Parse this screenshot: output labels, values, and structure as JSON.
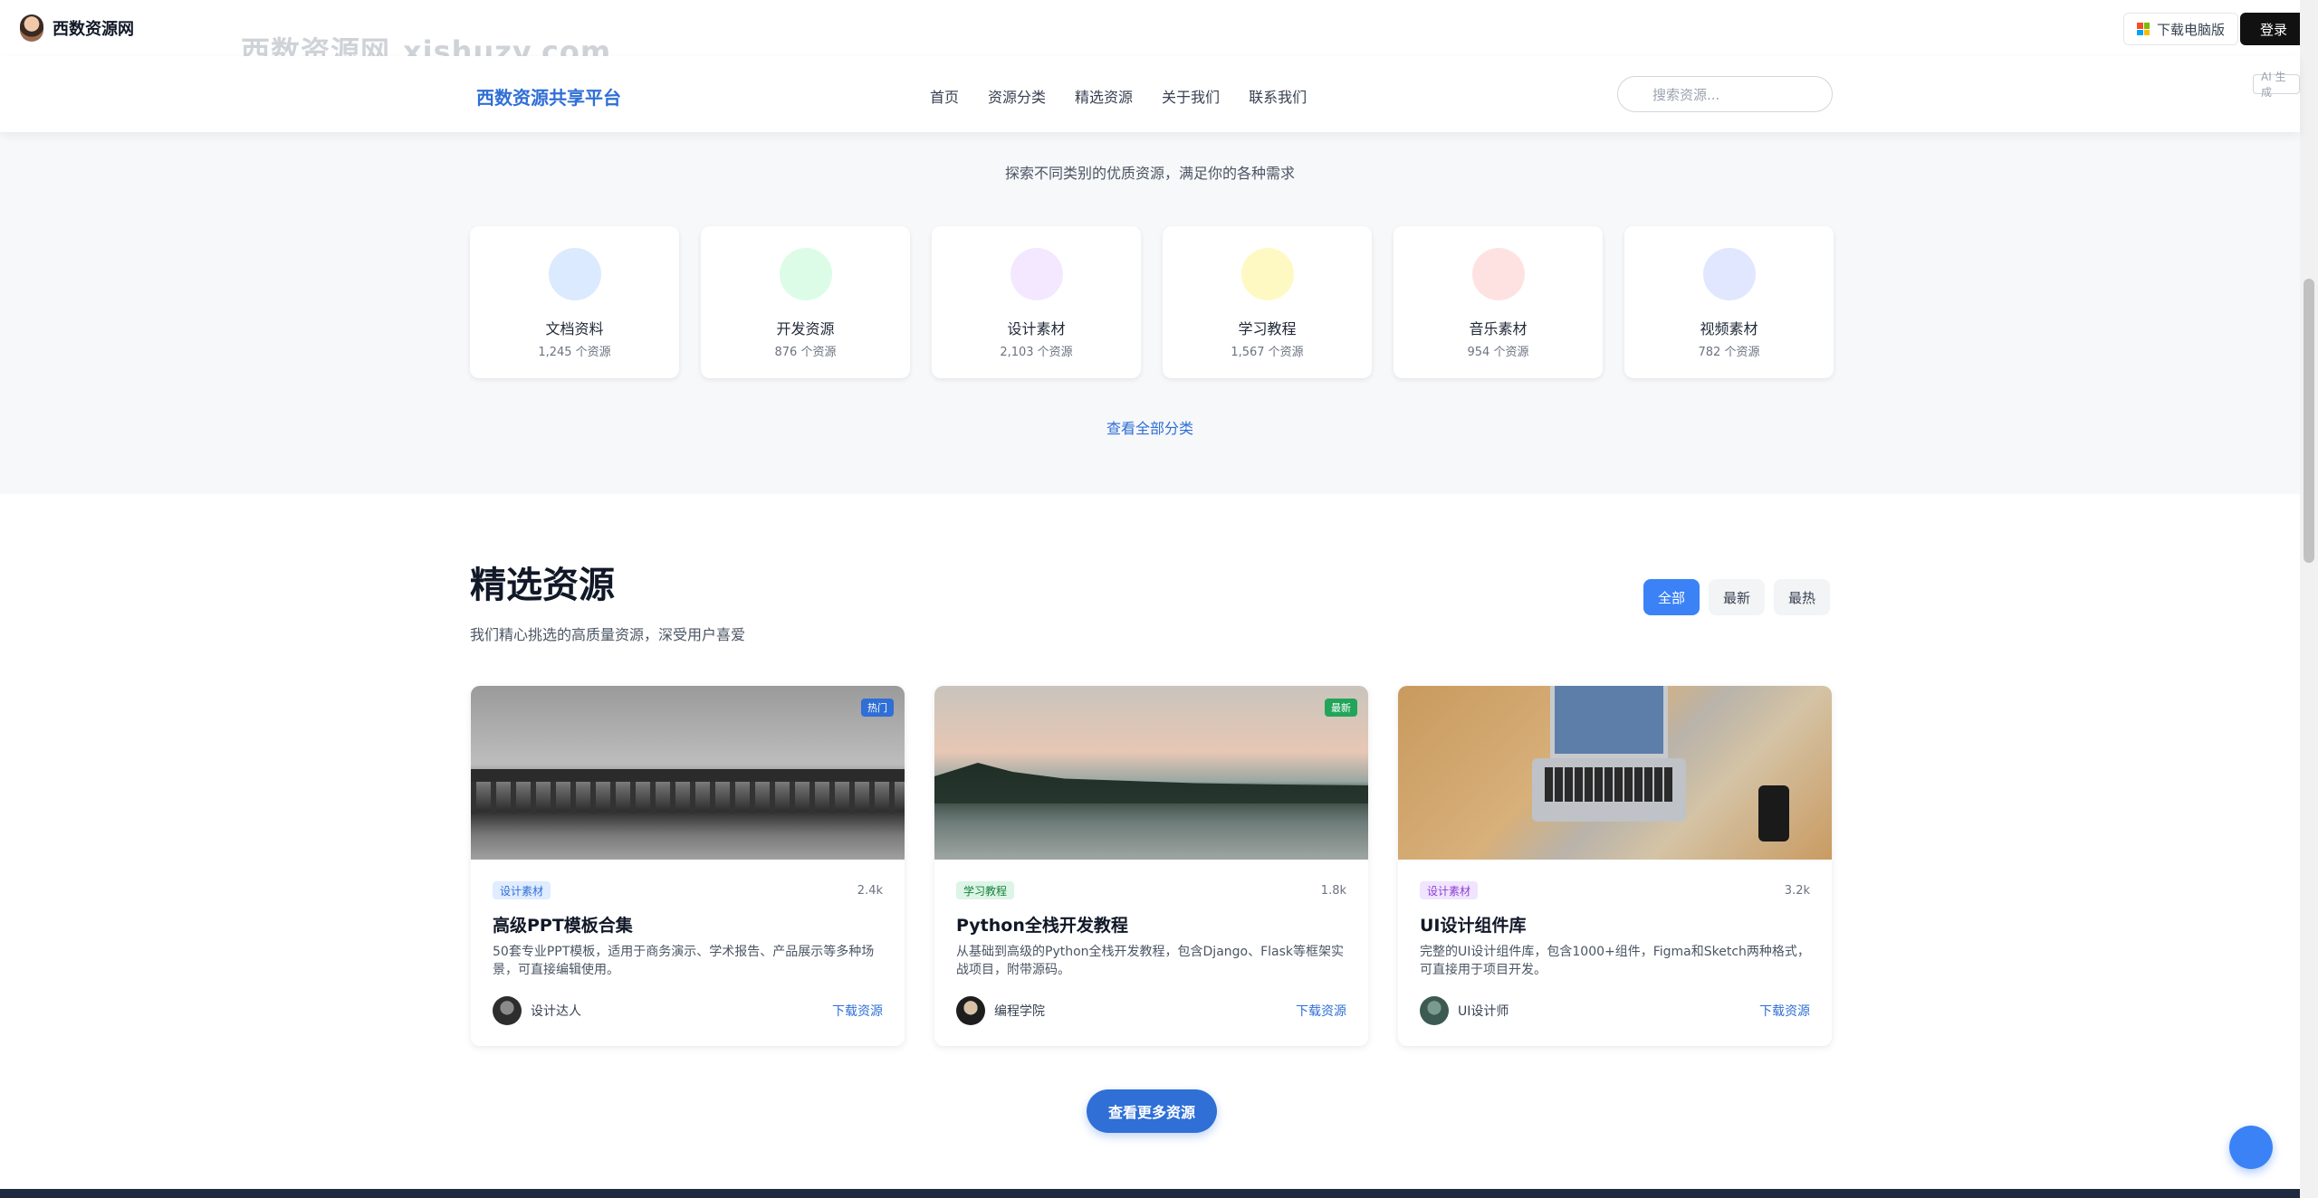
{
  "topbar": {
    "brand_name": "西数资源网",
    "watermark_cn": "西数资源网",
    "watermark_en": "xishuzy.com",
    "download_pc_label": "下载电脑版",
    "login_label": "登录"
  },
  "nav": {
    "site_title": "西数资源共享平台",
    "links": [
      "首页",
      "资源分类",
      "精选资源",
      "关于我们",
      "联系我们"
    ],
    "search_placeholder": "搜索资源...",
    "ai_tag": "AI 生成"
  },
  "categories": {
    "subtitle": "探索不同类别的优质资源，满足你的各种需求",
    "items": [
      {
        "name": "文档资料",
        "count": "1,245 个资源",
        "color": "#dbeafe"
      },
      {
        "name": "开发资源",
        "count": "876 个资源",
        "color": "#dcfce7"
      },
      {
        "name": "设计素材",
        "count": "2,103 个资源",
        "color": "#f3e8ff"
      },
      {
        "name": "学习教程",
        "count": "1,567 个资源",
        "color": "#fef9c3"
      },
      {
        "name": "音乐素材",
        "count": "954 个资源",
        "color": "#fee2e2"
      },
      {
        "name": "视频素材",
        "count": "782 个资源",
        "color": "#e0e7ff"
      }
    ],
    "view_all": "查看全部分类"
  },
  "featured": {
    "title": "精选资源",
    "subtitle": "我们精心挑选的高质量资源，深受用户喜爱",
    "filters": [
      "全部",
      "最新",
      "最热"
    ],
    "active_filter": "全部",
    "resources": [
      {
        "badge": "热门",
        "tag": "设计素材",
        "views": "2.4k",
        "title": "高级PPT模板合集",
        "desc": "50套专业PPT模板，适用于商务演示、学术报告、产品展示等多种场景，可直接编辑使用。",
        "author": "设计达人",
        "download": "下载资源"
      },
      {
        "badge": "最新",
        "tag": "学习教程",
        "views": "1.8k",
        "title": "Python全栈开发教程",
        "desc": "从基础到高级的Python全栈开发教程，包含Django、Flask等框架实战项目，附带源码。",
        "author": "编程学院",
        "download": "下载资源"
      },
      {
        "badge": "",
        "tag": "设计素材",
        "views": "3.2k",
        "title": "UI设计组件库",
        "desc": "完整的UI设计组件库，包含1000+组件，Figma和Sketch两种格式，可直接用于项目开发。",
        "author": "UI设计师",
        "download": "下载资源"
      }
    ],
    "more_button": "查看更多资源"
  },
  "colors": {
    "primary": "#2f6fd6",
    "accent_blue": "#3b82f6",
    "hot_badge": "#2f6fd6",
    "new_badge": "#22a55a",
    "footer": "#1e2a3f"
  }
}
